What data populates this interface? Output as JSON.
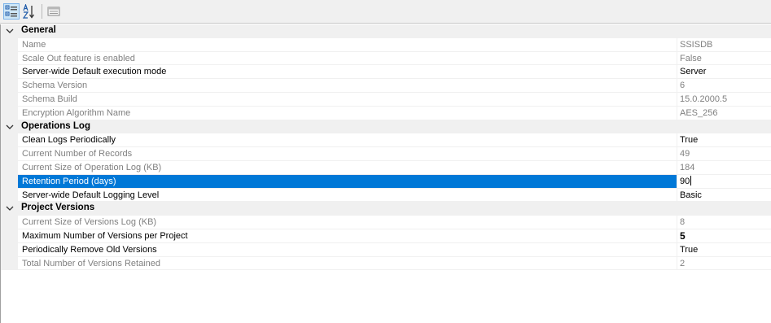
{
  "toolbar": {
    "categorized_icon": "categorized-view-icon",
    "alphabetical_icon": "alphabetical-sort-icon",
    "property_pages_icon": "property-pages-icon"
  },
  "categories": [
    {
      "label": "General",
      "properties": [
        {
          "name": "Name",
          "value": "SSISDB",
          "readonly": true
        },
        {
          "name": "Scale Out feature is enabled",
          "value": "False",
          "readonly": true
        },
        {
          "name": "Server-wide Default execution mode",
          "value": "Server",
          "readonly": false
        },
        {
          "name": "Schema Version",
          "value": "6",
          "readonly": true
        },
        {
          "name": "Schema Build",
          "value": "15.0.2000.5",
          "readonly": true
        },
        {
          "name": "Encryption Algorithm Name",
          "value": "AES_256",
          "readonly": true
        }
      ]
    },
    {
      "label": "Operations Log",
      "properties": [
        {
          "name": "Clean Logs Periodically",
          "value": "True",
          "readonly": false
        },
        {
          "name": "Current Number of Records",
          "value": "49",
          "readonly": true
        },
        {
          "name": "Current Size of Operation Log (KB)",
          "value": "184",
          "readonly": true
        },
        {
          "name": "Retention Period (days)",
          "value": "90",
          "readonly": false,
          "selected": true
        },
        {
          "name": "Server-wide Default Logging Level",
          "value": "Basic",
          "readonly": false
        }
      ]
    },
    {
      "label": "Project Versions",
      "properties": [
        {
          "name": "Current Size of Versions Log (KB)",
          "value": "8",
          "readonly": true
        },
        {
          "name": "Maximum Number of Versions per Project",
          "value": "5",
          "readonly": false,
          "bold": true
        },
        {
          "name": "Periodically Remove Old Versions",
          "value": "True",
          "readonly": false
        },
        {
          "name": "Total Number of Versions Retained",
          "value": "2",
          "readonly": true
        }
      ]
    }
  ]
}
